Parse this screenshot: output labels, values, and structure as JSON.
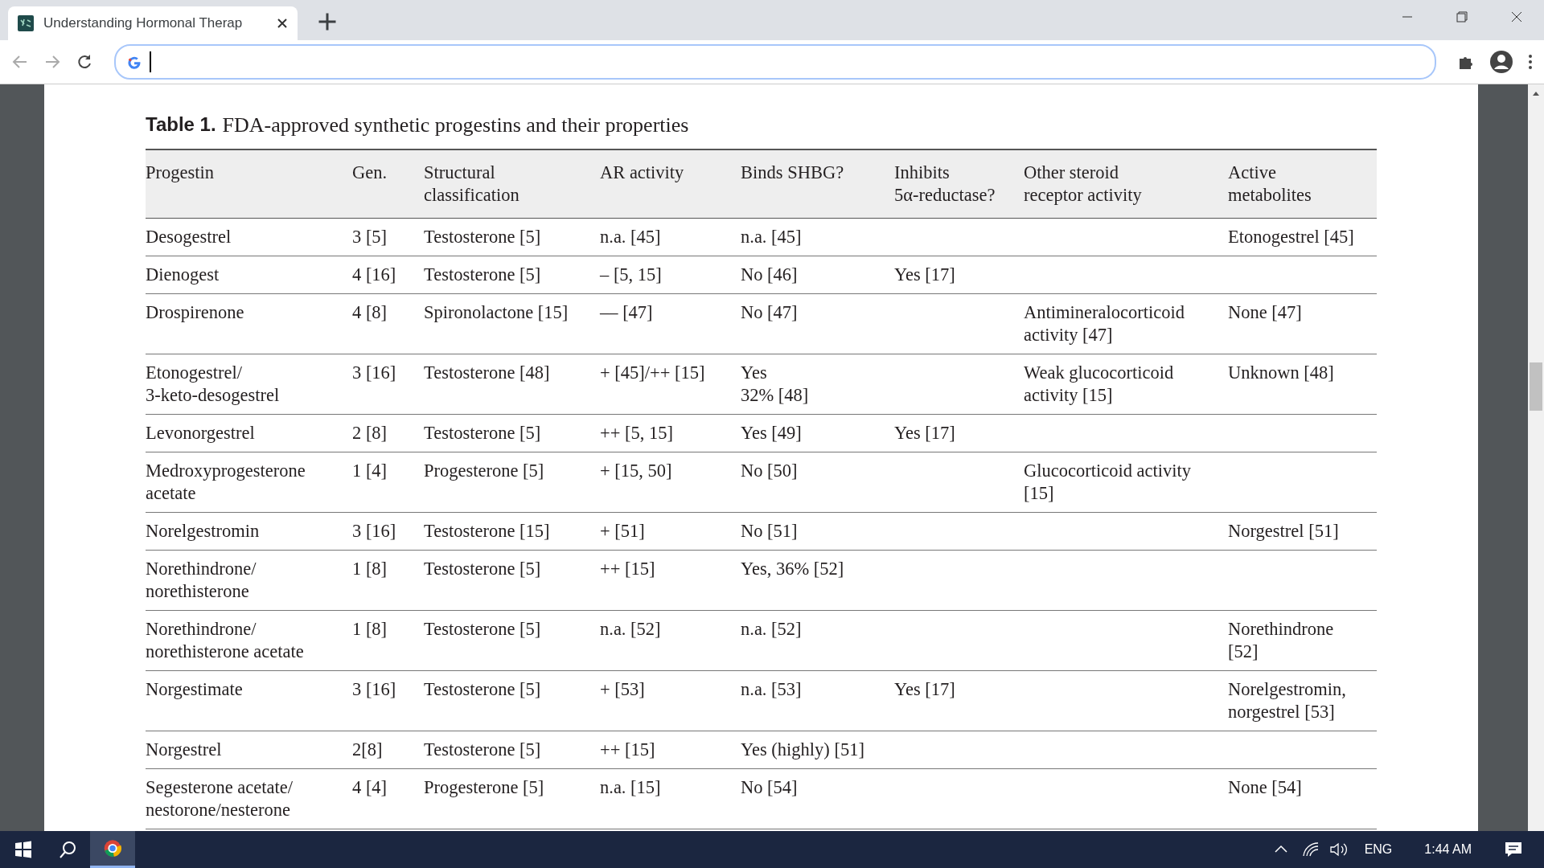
{
  "browser": {
    "tab_title": "Understanding Hormonal Therap"
  },
  "document": {
    "caption_label": "Table 1.",
    "caption_text": "FDA-approved synthetic progestins and their properties",
    "table": {
      "columns": [
        "Progestin",
        "Gen.",
        "Structural\nclassification",
        "AR activity",
        "Binds SHBG?",
        "Inhibits\n5α-reductase?",
        "Other steroid\nreceptor activity",
        "Active\nmetabolites"
      ],
      "rows": [
        {
          "cells": [
            "Desogestrel",
            "3 [5]",
            "Testosterone [5]",
            "n.a. [45]",
            "n.a. [45]",
            null,
            null,
            "Etonogestrel [45]"
          ]
        },
        {
          "cells": [
            "Dienogest",
            "4 [16]",
            "Testosterone [5]",
            "– [5, 15]",
            "No [46]",
            "Yes [17]",
            null,
            null
          ]
        },
        {
          "cells": [
            "Drospirenone",
            "4 [8]",
            "Spironolactone [15]",
            "–– [47]",
            "No [47]",
            null,
            "Antimineralocorticoid\nactivity [47]",
            "None [47]"
          ]
        },
        {
          "cells": [
            "Etonogestrel/\n3-keto-desogestrel",
            "3 [16]",
            "Testosterone [48]",
            "+ [45]/++ [15]",
            "Yes\n32% [48]",
            null,
            "Weak glucocorticoid\nactivity [15]",
            "Unknown [48]"
          ]
        },
        {
          "cells": [
            "Levonorgestrel",
            "2 [8]",
            "Testosterone [5]",
            "++ [5, 15]",
            "Yes [49]",
            "Yes [17]",
            null,
            null
          ]
        },
        {
          "cells": [
            "Medroxyprogesterone\nacetate",
            "1 [4]",
            "Progesterone [5]",
            "+ [15, 50]",
            "No [50]",
            null,
            "Glucocorticoid activity\n[15]",
            null
          ]
        },
        {
          "cells": [
            "Norelgestromin",
            "3 [16]",
            "Testosterone [15]",
            "+ [51]",
            "No [51]",
            null,
            null,
            "Norgestrel [51]"
          ]
        },
        {
          "cells": [
            "Norethindrone/\nnorethisterone",
            "1 [8]",
            "Testosterone [5]",
            "++ [15]",
            "Yes, 36% [52]",
            null,
            null,
            null
          ]
        },
        {
          "cells": [
            "Norethindrone/\nnorethisterone acetate",
            "1 [8]",
            "Testosterone [5]",
            "n.a. [52]",
            "n.a. [52]",
            null,
            null,
            "Norethindrone\n[52]"
          ]
        },
        {
          "cells": [
            "Norgestimate",
            "3 [16]",
            "Testosterone [5]",
            "+ [53]",
            "n.a. [53]",
            "Yes [17]",
            null,
            "Norelgestromin,\nnorgestrel [53]"
          ]
        },
        {
          "cells": [
            "Norgestrel",
            "2[8]",
            "Testosterone [5]",
            "++ [15]",
            "Yes (highly) [51]",
            null,
            null,
            null
          ]
        },
        {
          "cells": [
            "Segesterone acetate/\nnestorone/nesterone",
            "4 [4]",
            "Progesterone [5]",
            "n.a. [15]",
            "No [54]",
            null,
            null,
            "None [54]"
          ]
        }
      ]
    }
  },
  "taskbar": {
    "language": "ENG",
    "time": "1:44 AM"
  }
}
